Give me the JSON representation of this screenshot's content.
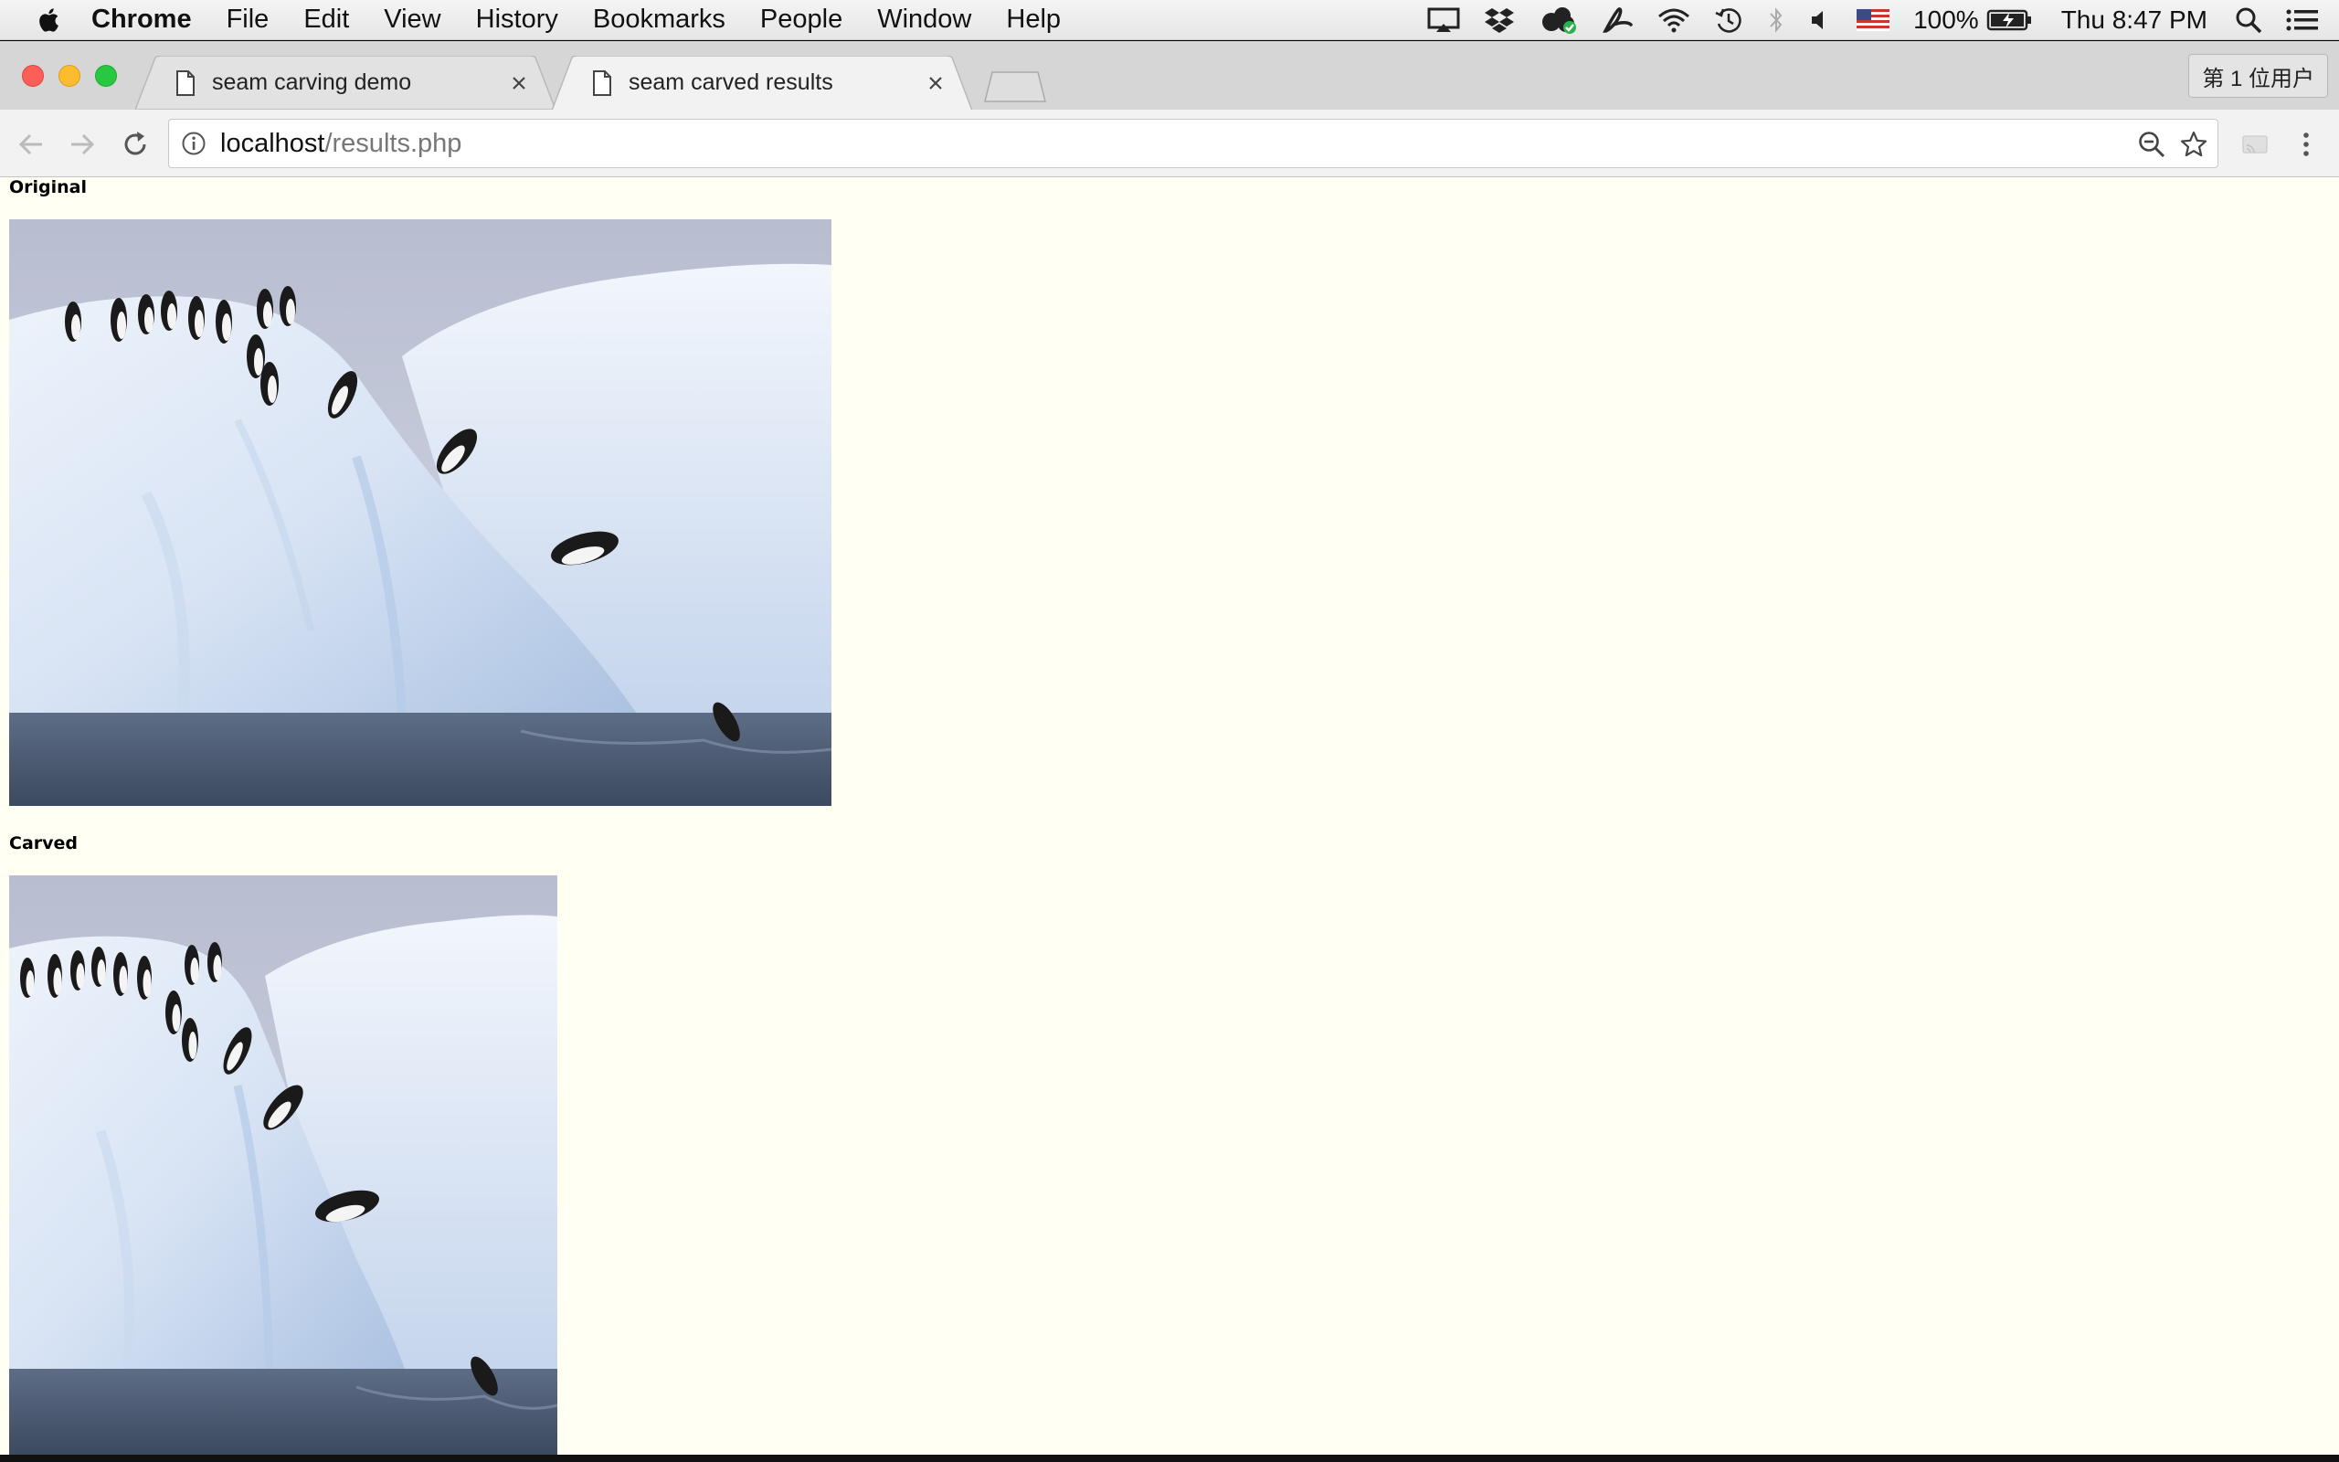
{
  "menubar": {
    "app_name": "Chrome",
    "items": [
      "File",
      "Edit",
      "View",
      "History",
      "Bookmarks",
      "People",
      "Window",
      "Help"
    ],
    "status": {
      "battery": "100%",
      "clock": "Thu 8:47 PM",
      "icons": [
        "airplay-icon",
        "dropbox-icon",
        "creative-cloud-icon",
        "acrobat-icon",
        "wifi-icon",
        "time-machine-icon",
        "bluetooth-icon",
        "volume-icon",
        "us-flag-icon",
        "battery-icon",
        "spotlight-icon",
        "notification-center-icon"
      ]
    }
  },
  "tabs": [
    {
      "title": "seam carving demo",
      "active": false
    },
    {
      "title": "seam carved results",
      "active": true
    }
  ],
  "profile_button": "第 1 位用户",
  "omnibox": {
    "host": "localhost",
    "path": "/results.php"
  },
  "page": {
    "original_label": "Original",
    "carved_label": "Carved",
    "background": "#fffff4"
  },
  "colors": {
    "close": "#fc5f57",
    "minimize": "#fdbc2e",
    "zoom": "#28c840"
  }
}
